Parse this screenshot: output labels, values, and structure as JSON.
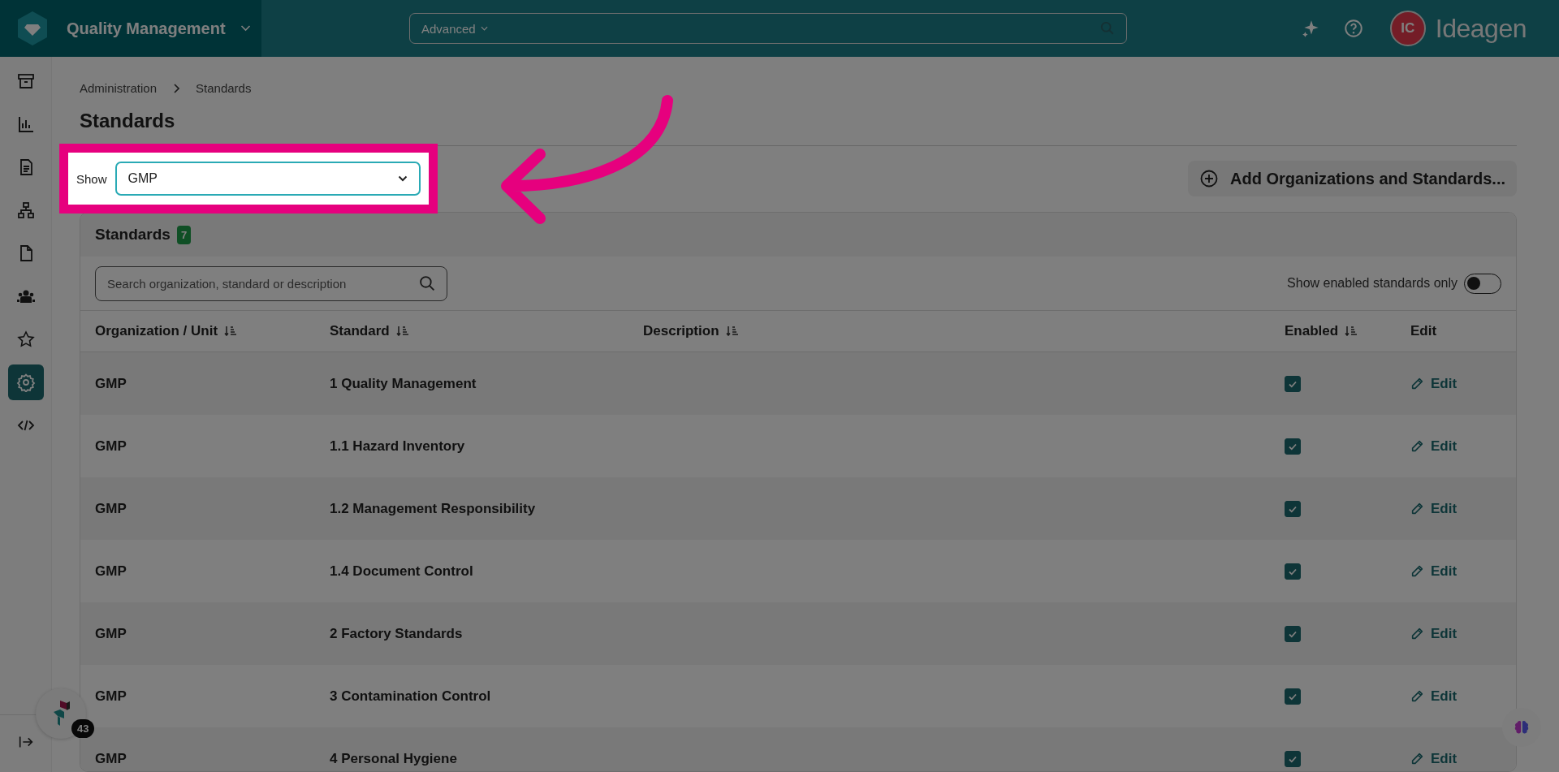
{
  "top_bar": {
    "app_name": "Quality Management",
    "search": {
      "mode": "Advanced"
    },
    "avatar": "IC",
    "logo": "Ideagen"
  },
  "sidebar": {
    "items": [
      {
        "selected": false
      },
      {
        "selected": false
      },
      {
        "selected": false
      },
      {
        "selected": false
      },
      {
        "selected": false
      },
      {
        "selected": false
      },
      {
        "selected": false
      },
      {
        "selected": true
      },
      {
        "selected": false
      }
    ]
  },
  "breadcrumb": [
    "Administration",
    "Standards"
  ],
  "title": "Standards",
  "filter": {
    "label": "Show",
    "value": "GMP"
  },
  "add_button": "Add Organizations and Standards...",
  "card": {
    "title": "Standards",
    "count": "7",
    "search": {
      "placeholder": "Search organization, standard or description"
    },
    "toggle": {
      "label": "Show enabled standards only",
      "on": false
    }
  },
  "table": {
    "columns": [
      {
        "label": "Organization / Unit",
        "sortable": true
      },
      {
        "label": "Standard",
        "sortable": true
      },
      {
        "label": "Description",
        "sortable": true
      },
      {
        "label": "Enabled",
        "sortable": true
      },
      {
        "label": "Edit",
        "sortable": false
      }
    ],
    "rows": [
      {
        "organization": "GMP",
        "standard": "1 Quality Management",
        "enabled": true,
        "edit": "Edit"
      },
      {
        "organization": "GMP",
        "standard": "1.1 Hazard Inventory",
        "enabled": true,
        "edit": "Edit"
      },
      {
        "organization": "GMP",
        "standard": "1.2 Management Responsibility",
        "enabled": true,
        "edit": "Edit"
      },
      {
        "organization": "GMP",
        "standard": "1.4 Document Control",
        "enabled": true,
        "edit": "Edit"
      },
      {
        "organization": "GMP",
        "standard": "2 Factory Standards",
        "enabled": true,
        "edit": "Edit"
      },
      {
        "organization": "GMP",
        "standard": "3 Contamination Control",
        "enabled": true,
        "edit": "Edit"
      },
      {
        "organization": "GMP",
        "standard": "4 Personal Hygiene",
        "enabled": true,
        "edit": "Edit"
      }
    ]
  },
  "help_widget": {
    "count": "43"
  }
}
